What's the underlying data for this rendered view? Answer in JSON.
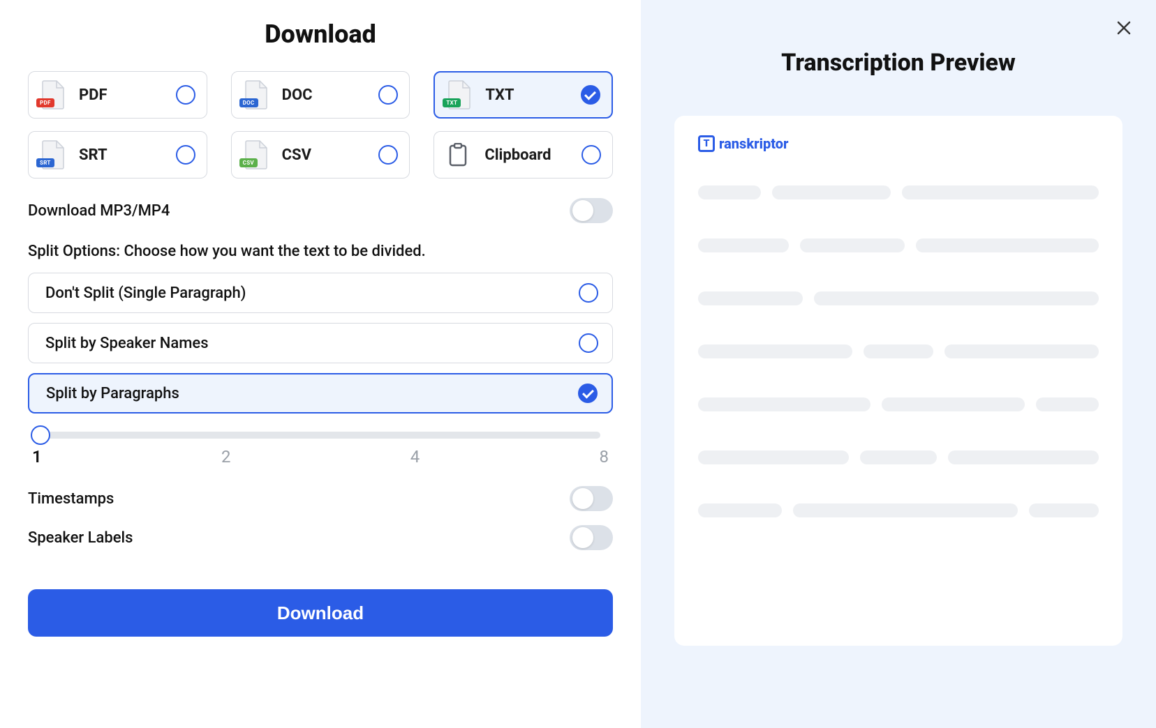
{
  "left": {
    "title": "Download",
    "formats": [
      {
        "label": "PDF",
        "badge": "PDF",
        "badgeClass": "pdf",
        "selected": false
      },
      {
        "label": "DOC",
        "badge": "DOC",
        "badgeClass": "doc",
        "selected": false
      },
      {
        "label": "TXT",
        "badge": "TXT",
        "badgeClass": "txt",
        "selected": true
      },
      {
        "label": "SRT",
        "badge": "SRT",
        "badgeClass": "srt",
        "selected": false
      },
      {
        "label": "CSV",
        "badge": "CSV",
        "badgeClass": "csv",
        "selected": false
      },
      {
        "label": "Clipboard",
        "clipboard": true,
        "selected": false
      }
    ],
    "mp3mp4": {
      "label": "Download MP3/MP4",
      "enabled": false
    },
    "splitHeading": "Split Options: Choose how you want the text to be divided.",
    "splitOptions": [
      {
        "label": "Don't Split (Single Paragraph)",
        "selected": false
      },
      {
        "label": "Split by Speaker Names",
        "selected": false
      },
      {
        "label": "Split by Paragraphs",
        "selected": true
      }
    ],
    "slider": {
      "value": 1,
      "ticks": [
        "1",
        "2",
        "4",
        "8"
      ]
    },
    "timestamps": {
      "label": "Timestamps",
      "enabled": false
    },
    "speakerLabels": {
      "label": "Speaker Labels",
      "enabled": false
    },
    "downloadButton": "Download"
  },
  "right": {
    "title": "Transcription Preview",
    "brand": "ranskriptor",
    "brandLetter": "T"
  }
}
